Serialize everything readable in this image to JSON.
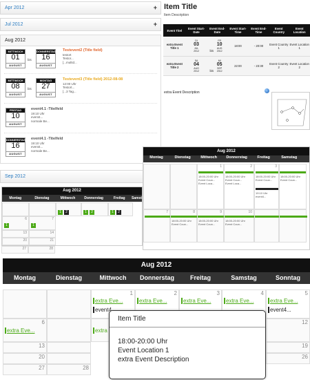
{
  "accordion": {
    "apr": "Apr 2012",
    "jul": "Jul 2012",
    "aug": "Aug 2012",
    "sep": "Sep 2012",
    "plus": "+"
  },
  "events": [
    {
      "s_day": "MITTWOCH",
      "s_num": "01",
      "s_mon": "AUGUST",
      "s_yr": "2012",
      "e_day": "DONNERSTAG",
      "e_num": "16",
      "e_mon": "AUGUST",
      "e_yr": "2012",
      "title": "Testevent2 (Title field)",
      "l1": "testort",
      "l2": "Testor...",
      "l3": "[...multid...",
      "color": "#e0642b"
    },
    {
      "s_day": "MITTWOCH",
      "s_num": "08",
      "s_mon": "AUGUST",
      "s_yr": "2012",
      "e_day": "MONTAG",
      "e_num": "27",
      "e_mon": "AUGUST",
      "e_yr": "2012",
      "title": "Testevent3 (Title field) 2012-08-08",
      "l1": "12:00 Uhr",
      "l2": "Testort...",
      "l3": "[...3 Tag...",
      "color": "#e8a81c"
    },
    {
      "s_day": "FREITAG",
      "s_num": "10",
      "s_mon": "AUGUST",
      "s_yr": "2012",
      "title": "event4.1 -Titelfeld",
      "l1": "19:10 Uhr",
      "l2": "event4...",
      "l3": "normale Be..."
    },
    {
      "s_day": "DONNERSTAG",
      "s_num": "16",
      "s_mon": "AUGUST",
      "s_yr": "2012",
      "title": "event4.1 -Titelfeld",
      "l1": "19:10 Uhr",
      "l2": "event4...",
      "l3": "normale Be..."
    }
  ],
  "bis": "bis",
  "item": {
    "title": "Item Title",
    "desc": "Item Description",
    "extra": "extra Event Description"
  },
  "table": {
    "headers": [
      "Event Titel",
      "Event Start-Date",
      "Event End-Date",
      "Event Start-Time",
      "Event End-Time",
      "Event Country",
      "Event Location"
    ],
    "rows": [
      {
        "t": "extra Event Title 1",
        "sd": "DI",
        "sn": "03",
        "sm": "JUL",
        "sy": "2012",
        "bis": "bis",
        "ed": "FR",
        "en": "10",
        "em": "AUG",
        "ey": "2012",
        "st": "18:00",
        "dash": "-",
        "et": "20:00",
        "c": "Event Country 1",
        "l": "Event Location 1"
      },
      {
        "t": "extra Event Title 2",
        "sd": "SA",
        "sn": "04",
        "sm": "AUG",
        "sy": "2012",
        "bis": "bis",
        "ed": "MI",
        "en": "05",
        "em": "SEP",
        "ey": "2012",
        "st": "22:00",
        "dash": "-",
        "et": "23:30",
        "c": "Event Country 2",
        "l": "Event Location 2"
      }
    ]
  },
  "days": [
    "Montag",
    "Dienstag",
    "Mittwoch",
    "Donnerstag",
    "Freitag",
    "Samstag",
    "Sonntag"
  ],
  "month": "Aug 2012",
  "mid": {
    "n1": "1",
    "n2": "2",
    "n3": "3",
    "n8": "8",
    "n9": "9",
    "n10": "10",
    "n7": "7",
    "time": "18:00-20:00 Uhr",
    "loc": "Event Coun...",
    "loc2": "Event Loca...",
    "e4": "19:10 Uhr",
    "e4b": "event4..."
  },
  "small": {
    "nums": [
      "6",
      "7",
      "13",
      "14",
      "20",
      "21",
      "27",
      "28"
    ],
    "b1": "1",
    "b2": "2"
  },
  "big": {
    "nums": [
      "1",
      "2",
      "3",
      "4",
      "5",
      "6",
      "12",
      "13",
      "19",
      "20",
      "26",
      "27",
      "28"
    ],
    "ev": "extra Eve...",
    "ev2": "extra Eve...",
    "ev3": "event4..."
  },
  "tooltip": {
    "title": "Item Title",
    "time": "18:00-20:00 Uhr",
    "loc": "Event Location 1",
    "desc": "extra Event Description"
  }
}
